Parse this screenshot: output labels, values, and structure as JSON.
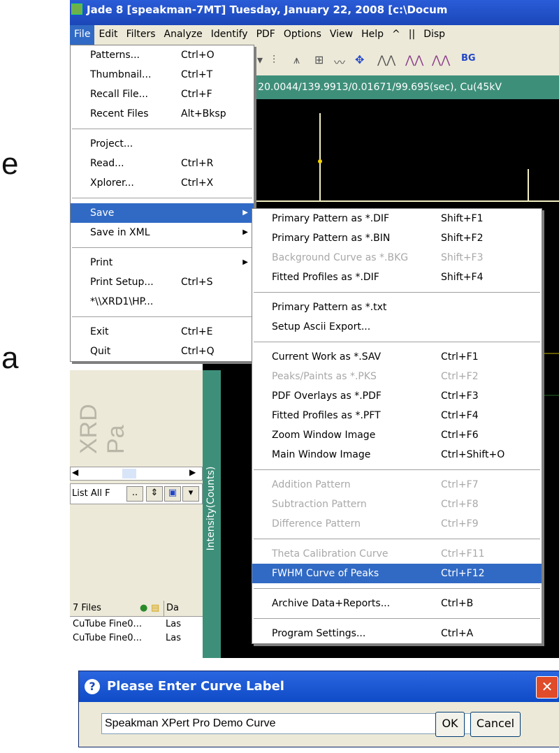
{
  "slide": {
    "letter_e": "e",
    "letter_a": "a"
  },
  "window": {
    "title": "Jade 8 [speakman-7MT] Tuesday, January 22, 2008 [c:\\Docum",
    "menus": [
      "File",
      "Edit",
      "Filters",
      "Analyze",
      "Identify",
      "PDF",
      "Options",
      "View",
      "Help",
      "^",
      "||",
      "Disp"
    ],
    "info": ": 20.0044/139.9913/0.01671/99.695(sec), Cu(45kV",
    "y_axis_label": "Intensity(Counts)",
    "left_panel": {
      "watermark": "XRD Pa",
      "list_filter": "List All F",
      "files_count": "7 Files",
      "col_da": "Da",
      "rows": [
        {
          "name": "CuTube Fine0...",
          "col": "Las"
        },
        {
          "name": "CuTube Fine0...",
          "col": "Las"
        }
      ]
    }
  },
  "file_menu": {
    "items": [
      {
        "label": "Patterns...",
        "key": "Ctrl+O"
      },
      {
        "label": "Thumbnail...",
        "key": "Ctrl+T"
      },
      {
        "label": "Recall File...",
        "key": "Ctrl+F"
      },
      {
        "label": "Recent Files",
        "key": "Alt+Bksp"
      },
      {
        "sep": true
      },
      {
        "label": "Project...",
        "key": ""
      },
      {
        "label": "Read...",
        "key": "Ctrl+R"
      },
      {
        "label": "Xplorer...",
        "key": "Ctrl+X"
      },
      {
        "sep": true
      },
      {
        "label": "Save",
        "key": "",
        "sub": true,
        "selected": true
      },
      {
        "label": "Save in XML",
        "key": "",
        "sub": true
      },
      {
        "sep": true
      },
      {
        "label": "Print",
        "key": "",
        "sub": true
      },
      {
        "label": "Print Setup...",
        "key": "Ctrl+S"
      },
      {
        "label": "*\\\\XRD1\\HP...",
        "key": ""
      },
      {
        "sep": true
      },
      {
        "label": "Exit",
        "key": "Ctrl+E"
      },
      {
        "label": "Quit",
        "key": "Ctrl+Q"
      }
    ]
  },
  "save_menu": {
    "items": [
      {
        "label": "Primary Pattern as *.DIF",
        "key": "Shift+F1"
      },
      {
        "label": "Primary Pattern as *.BIN",
        "key": "Shift+F2"
      },
      {
        "label": "Background Curve as *.BKG",
        "key": "Shift+F3",
        "disabled": true
      },
      {
        "label": "Fitted Profiles as *.DIF",
        "key": "Shift+F4"
      },
      {
        "sep": true
      },
      {
        "label": "Primary Pattern as *.txt",
        "key": ""
      },
      {
        "label": "Setup Ascii Export...",
        "key": ""
      },
      {
        "sep": true
      },
      {
        "label": "Current Work as *.SAV",
        "key": "Ctrl+F1"
      },
      {
        "label": "Peaks/Paints as *.PKS",
        "key": "Ctrl+F2",
        "disabled": true
      },
      {
        "label": "PDF Overlays as *.PDF",
        "key": "Ctrl+F3"
      },
      {
        "label": "Fitted Profiles as *.PFT",
        "key": "Ctrl+F4"
      },
      {
        "label": "Zoom Window Image",
        "key": "Ctrl+F6"
      },
      {
        "label": "Main Window Image",
        "key": "Ctrl+Shift+O"
      },
      {
        "sep": true
      },
      {
        "label": "Addition Pattern",
        "key": "Ctrl+F7",
        "disabled": true
      },
      {
        "label": "Subtraction Pattern",
        "key": "Ctrl+F8",
        "disabled": true
      },
      {
        "label": "Difference Pattern",
        "key": "Ctrl+F9",
        "disabled": true
      },
      {
        "sep": true
      },
      {
        "label": "Theta Calibration Curve",
        "key": "Ctrl+F11",
        "disabled": true
      },
      {
        "label": "FWHM Curve of Peaks",
        "key": "Ctrl+F12",
        "selected": true
      },
      {
        "sep": true
      },
      {
        "label": "Archive Data+Reports...",
        "key": "Ctrl+B"
      },
      {
        "sep": true
      },
      {
        "label": "Program Settings...",
        "key": "Ctrl+A"
      }
    ]
  },
  "dialog": {
    "title": "Please Enter Curve Label",
    "input_value": "Speakman XPert Pro Demo Curve",
    "ok_label": "OK",
    "cancel_label": "Cancel",
    "close_glyph": "✕"
  },
  "colors": {
    "highlight": "#316ac5",
    "titlebar": "#2a5cd8",
    "teal": "#3e8f7a"
  }
}
